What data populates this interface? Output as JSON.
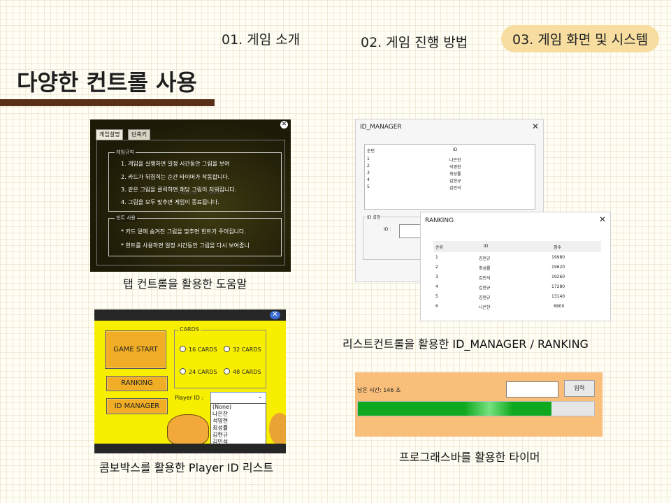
{
  "nav": {
    "item1": "01. 게임 소개",
    "item2": "02. 게임 진행 방법",
    "item3": "03. 게임 화면 및 시스템"
  },
  "page_title": "다양한 컨트롤 사용",
  "help_window": {
    "tabs": [
      "게임설명",
      "단축키"
    ],
    "group1_label": "게임규칙",
    "rules": [
      "1. 게임을 실행하면 일정 시간동안 그림을 보여",
      "2. 카드가 뒤집히는 순간 타이머가 작동합니다.",
      "3. 같은 그림을 클릭하면 해당 그림이 지워집니다.",
      "4. 그림을 모두 맞추면 게임이 종료됩니다."
    ],
    "group2_label": "힌트 사용",
    "hints": [
      "* 카드 밑에 숨겨진 그림을 맞추면 힌트가 주어집니다.",
      "* 힌트를 사용하면 일정 시간동안 그림을 다시 보여줍니"
    ],
    "bg_player_label": "Player ID :",
    "bg_combo_value": "(None)",
    "caption": "탭 컨트롤을 활용한 도움말"
  },
  "game_window": {
    "game_start": "GAME START",
    "ranking": "RANKING",
    "id_manager": "ID MANAGER",
    "cards_label": "CARDS",
    "cards_options": [
      "16 CARDS",
      "32 CARDS",
      "24 CARDS",
      "48 CARDS"
    ],
    "player_id_label": "Player ID :",
    "dropdown_items": [
      "(None)",
      "나은찬",
      "석영현",
      "최성률",
      "김현규",
      "김민석"
    ],
    "caption": "콤보박스를 활용한 Player ID 리스트"
  },
  "id_manager_window": {
    "title": "ID_MANAGER",
    "close": "✕",
    "columns": [
      "순번",
      "ID"
    ],
    "rows": [
      [
        "1",
        "나은찬"
      ],
      [
        "2",
        "석영현"
      ],
      [
        "3",
        "최성률"
      ],
      [
        "4",
        "김현규"
      ],
      [
        "5",
        "김민석"
      ]
    ],
    "group_label": "ID 설정",
    "id_field_label": "ID :"
  },
  "ranking_window": {
    "title": "RANKING",
    "close": "✕",
    "columns": [
      "순위",
      "ID",
      "점수"
    ],
    "rows": [
      [
        "1",
        "김현규",
        "19980"
      ],
      [
        "2",
        "최성률",
        "19620"
      ],
      [
        "3",
        "김민석",
        "19260"
      ],
      [
        "4",
        "김현규",
        "17280"
      ],
      [
        "5",
        "김현규",
        "13140"
      ],
      [
        "6",
        "나은찬",
        "6800"
      ]
    ],
    "caption": "리스트컨트롤을 활용한 ID_MANAGER / RANKING"
  },
  "timer_window": {
    "remaining_label": "남은 시간: 146 초",
    "input_button": "입력",
    "progress_fraction": 0.82,
    "caption": "프로그래스바를 활용한 타이머"
  },
  "colors": {
    "accent_bar": "#5a2f17",
    "nav_active_bg": "#f7dea0",
    "game_bg": "#f8ee00",
    "button_orange": "#f0ad25",
    "timer_bg": "#f8be7a",
    "progress_green": "#10a81f"
  },
  "icons": {
    "help_close": "close-icon",
    "game_close": "close-icon",
    "combo_arrow": "chevron-down-icon"
  }
}
